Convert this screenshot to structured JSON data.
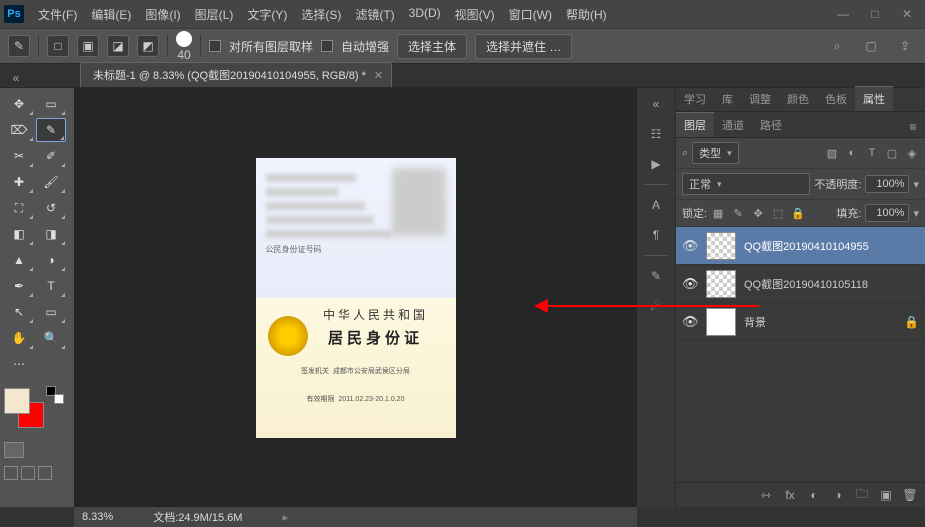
{
  "menubar": {
    "items": [
      "文件(F)",
      "编辑(E)",
      "图像(I)",
      "图层(L)",
      "文字(Y)",
      "选择(S)",
      "滤镜(T)",
      "3D(D)",
      "视图(V)",
      "窗口(W)",
      "帮助(H)"
    ]
  },
  "options": {
    "brush_size": "40",
    "sample_all_label": "对所有图层取样",
    "auto_enhance_label": "自动增强",
    "select_subject": "选择主体",
    "select_and_mask": "选择并遮住 …"
  },
  "document": {
    "tab_title": "未标题-1 @ 8.33% (QQ截图20190410104955, RGB/8) *",
    "zoom": "8.33%",
    "doc_info": "文档:24.9M/15.6M"
  },
  "id_card": {
    "top_label": "公民身份证号码",
    "country": "中华人民共和国",
    "doc_type": "居民身份证",
    "issuer_label": "签发机关",
    "issuer": "成都市公安局武侯区分局",
    "valid_label": "有效期限",
    "valid": "2011.02.23-20.1.0.20"
  },
  "panels": {
    "top_tabs": [
      "学习",
      "库",
      "调整",
      "颜色",
      "色板",
      "属性"
    ],
    "layer_tabs": [
      "图层",
      "通道",
      "路径"
    ],
    "filter_label": "类型",
    "blend_mode": "正常",
    "opacity_label": "不透明度:",
    "opacity_value": "100%",
    "lock_label": "锁定:",
    "fill_label": "填充:",
    "fill_value": "100%",
    "layers": [
      {
        "name": "QQ截图20190410104955",
        "selected": true,
        "locked": false,
        "transparent": true
      },
      {
        "name": "QQ截图20190410105118",
        "selected": false,
        "locked": false,
        "transparent": true
      },
      {
        "name": "背景",
        "selected": false,
        "locked": true,
        "transparent": false
      }
    ]
  }
}
